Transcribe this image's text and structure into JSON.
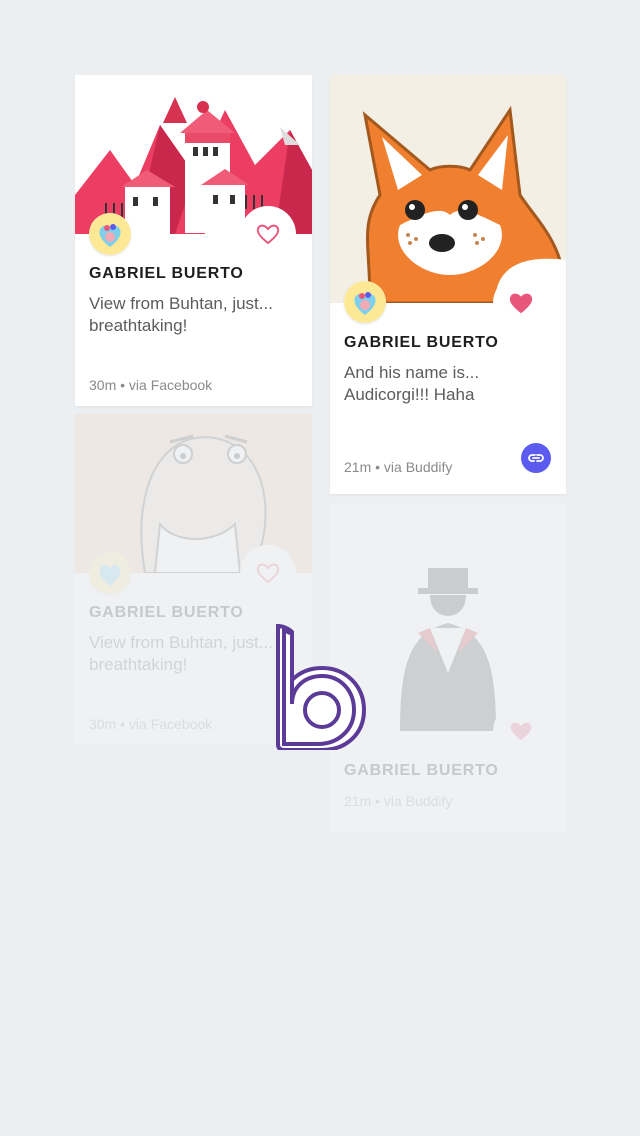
{
  "colors": {
    "background": "#eceff1",
    "heart": "#e8577b",
    "link": "#5b5bf0",
    "logo": "#5b3b97"
  },
  "cards": [
    {
      "author": "GABRIEL BUERTO",
      "text": "View from Buhtan, just... breathtaking!",
      "meta": "30m • via Facebook",
      "liked": false,
      "image": "mountain-castle"
    },
    {
      "author": "GABRIEL BUERTO",
      "text": "And his name is... Audicorgi!!! Haha",
      "meta": "21m • via Buddify",
      "liked": true,
      "image": "corgi"
    },
    {
      "author": "GABRIEL BUERTO",
      "text": "View from Buhtan, just... breathtaking!",
      "meta": "30m • via Facebook",
      "liked": false,
      "image": "old-man"
    },
    {
      "author": "GABRIEL BUERTO",
      "meta": "21m • via Buddify",
      "liked": true,
      "image": "gentleman"
    }
  ],
  "logo": "b"
}
